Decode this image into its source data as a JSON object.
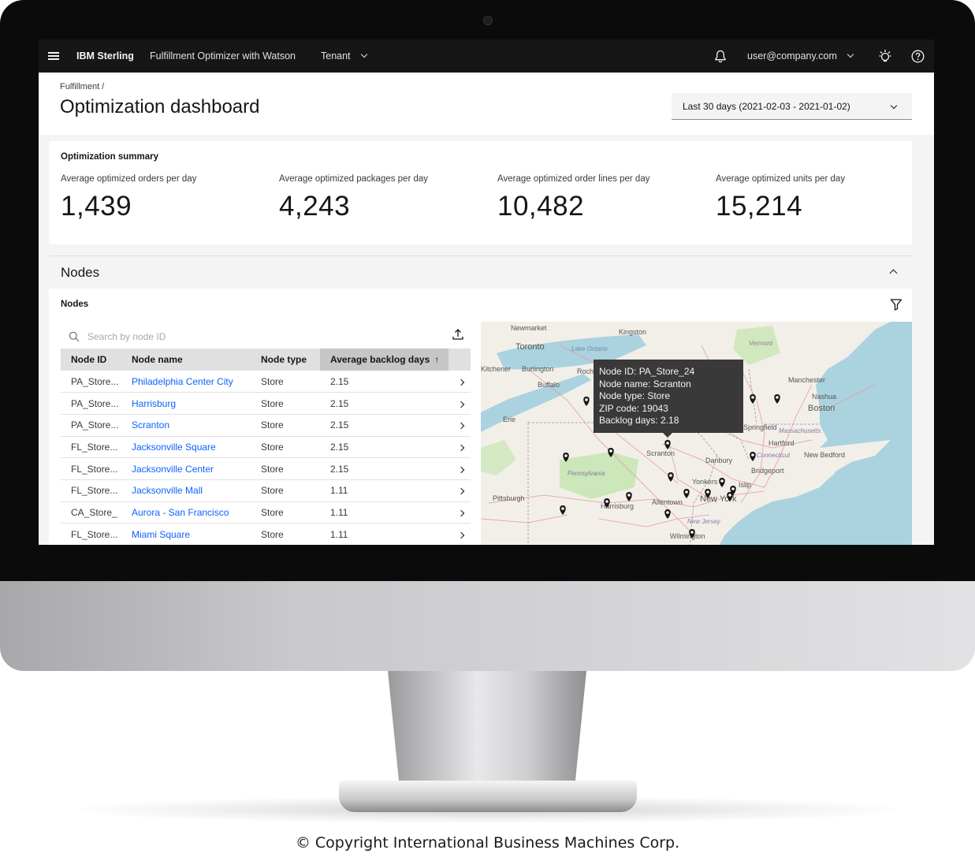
{
  "topbar": {
    "brand": "IBM Sterling",
    "product": "Fulfillment Optimizer with Watson",
    "tenant": "Tenant",
    "user": "user@company.com"
  },
  "page": {
    "breadcrumb": "Fulfillment  /",
    "title": "Optimization dashboard",
    "date_range": "Last 30 days (2021-02-03 - 2021-01-02)"
  },
  "summary": {
    "title": "Optimization summary",
    "metrics": [
      {
        "label": "Average optimized orders per day",
        "value": "1,439"
      },
      {
        "label": "Average optimized packages per day",
        "value": "4,243"
      },
      {
        "label": "Average optimized order lines per day",
        "value": "10,482"
      },
      {
        "label": "Average optimized units per day",
        "value": "15,214"
      }
    ]
  },
  "nodes": {
    "accordion_title": "Nodes",
    "panel_title": "Nodes",
    "search_placeholder": "Search by node ID",
    "columns": [
      "Node ID",
      "Node name",
      "Node type",
      "Average backlog days"
    ],
    "sort_indicator": "↑",
    "rows": [
      {
        "id": "PA_Store...",
        "name": "Philadelphia Center City",
        "type": "Store",
        "backlog": "2.15"
      },
      {
        "id": "PA_Store...",
        "name": "Harrisburg",
        "type": "Store",
        "backlog": "2.15"
      },
      {
        "id": "PA_Store...",
        "name": "Scranton",
        "type": "Store",
        "backlog": "2.15"
      },
      {
        "id": "FL_Store...",
        "name": "Jacksonville Square",
        "type": "Store",
        "backlog": "2.15"
      },
      {
        "id": "FL_Store...",
        "name": "Jacksonville Center",
        "type": "Store",
        "backlog": "2.15"
      },
      {
        "id": "FL_Store...",
        "name": "Jacksonville Mall",
        "type": "Store",
        "backlog": "1.11"
      },
      {
        "id": "CA_Store_",
        "name": "Aurora - San Francisco",
        "type": "Store",
        "backlog": "1.11"
      },
      {
        "id": "FL_Store...",
        "name": "Miami Square",
        "type": "Store",
        "backlog": "1.11"
      }
    ]
  },
  "map": {
    "labels": [
      "Newmarket",
      "Kingston",
      "Toronto",
      "Lake Ontario",
      "Vermont",
      "Kitchener",
      "Burlington",
      "Rochester",
      "Buffalo",
      "Manchester",
      "Nashua",
      "Boston",
      "Erie",
      "Springfield",
      "Massachusetts",
      "Hartford",
      "Scranton",
      "Connecticut",
      "New Bedford",
      "Danbury",
      "Pennsylvania",
      "Bridgeport",
      "Yonkers",
      "Islip",
      "Pittsburgh",
      "Harrisburg",
      "Allentown",
      "New York",
      "New Jersey",
      "Wilmington"
    ],
    "tooltip": {
      "node_id": "Node ID: PA_Store_24",
      "node_name": "Node name: Scranton",
      "node_type": "Node type: Store",
      "zip": "ZIP code: 19043",
      "backlog": "Backlog days: 2.18"
    }
  },
  "footer": {
    "copyright": "© Copyright International Business Machines Corp."
  },
  "colors": {
    "topbar": "#161616",
    "link": "#0f62fe",
    "water": "#aad3df",
    "land": "#f2efe9",
    "forest": "#c8e6b4",
    "tooltip": "#393939"
  }
}
